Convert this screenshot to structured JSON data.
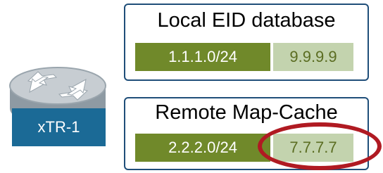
{
  "router": {
    "label": "xTR-1"
  },
  "local_eid_db": {
    "title": "Local EID database",
    "prefix": "1.1.1.0/24",
    "rloc": "9.9.9.9"
  },
  "remote_map_cache": {
    "title": "Remote Map-Cache",
    "prefix": "2.2.2.0/24",
    "rloc": "7.7.7.7"
  },
  "colors": {
    "router_blue": "#1b6a96",
    "box_border": "#1f4e79",
    "prefix_green": "#70892a",
    "rloc_light_green": "#c3d3ae",
    "highlight_red": "#b01a22"
  }
}
